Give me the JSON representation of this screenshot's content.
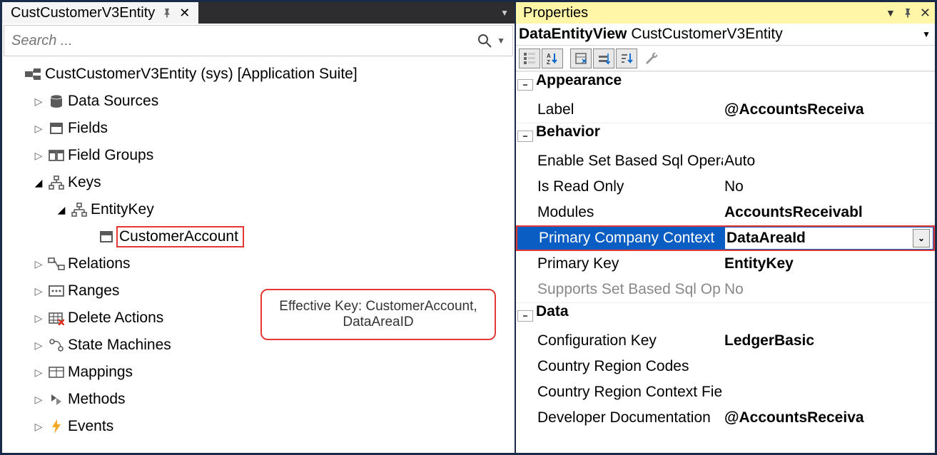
{
  "tab": {
    "title": "CustCustomerV3Entity"
  },
  "search": {
    "placeholder": "Search ..."
  },
  "tree": {
    "root": {
      "label": "CustCustomerV3Entity (sys) [Application Suite]"
    },
    "data_sources": {
      "label": "Data Sources"
    },
    "fields": {
      "label": "Fields"
    },
    "field_groups": {
      "label": "Field Groups"
    },
    "keys": {
      "label": "Keys"
    },
    "entity_key": {
      "label": "EntityKey"
    },
    "customer_account": {
      "label": "CustomerAccount"
    },
    "relations": {
      "label": "Relations"
    },
    "ranges": {
      "label": "Ranges"
    },
    "delete_actions": {
      "label": "Delete Actions"
    },
    "state_machines": {
      "label": "State Machines"
    },
    "mappings": {
      "label": "Mappings"
    },
    "methods": {
      "label": "Methods"
    },
    "events": {
      "label": "Events"
    }
  },
  "callout": {
    "line1": "Effective Key: CustomerAccount,",
    "line2": "DataAreaID"
  },
  "props": {
    "title": "Properties",
    "subtitle_type": "DataEntityView",
    "subtitle_name": "CustCustomerV3Entity",
    "categories": {
      "appearance": "Appearance",
      "behavior": "Behavior",
      "data": "Data"
    },
    "rows": {
      "label": {
        "name": "Label",
        "value": "@AccountsReceiva"
      },
      "enable_set_based": {
        "name": "Enable Set Based Sql Opera",
        "value": "Auto"
      },
      "is_read_only": {
        "name": "Is Read Only",
        "value": "No"
      },
      "modules": {
        "name": "Modules",
        "value": "AccountsReceivabl"
      },
      "primary_company_context": {
        "name": "Primary Company Context",
        "value": "DataAreaId"
      },
      "primary_key": {
        "name": "Primary Key",
        "value": "EntityKey"
      },
      "supports_set_based": {
        "name": "Supports Set Based Sql Op",
        "value": "No"
      },
      "configuration_key": {
        "name": "Configuration Key",
        "value": "LedgerBasic"
      },
      "country_region_codes": {
        "name": "Country Region Codes",
        "value": ""
      },
      "country_region_context": {
        "name": "Country Region Context Fie",
        "value": ""
      },
      "developer_documentation": {
        "name": "Developer Documentation",
        "value": "@AccountsReceiva"
      }
    }
  }
}
